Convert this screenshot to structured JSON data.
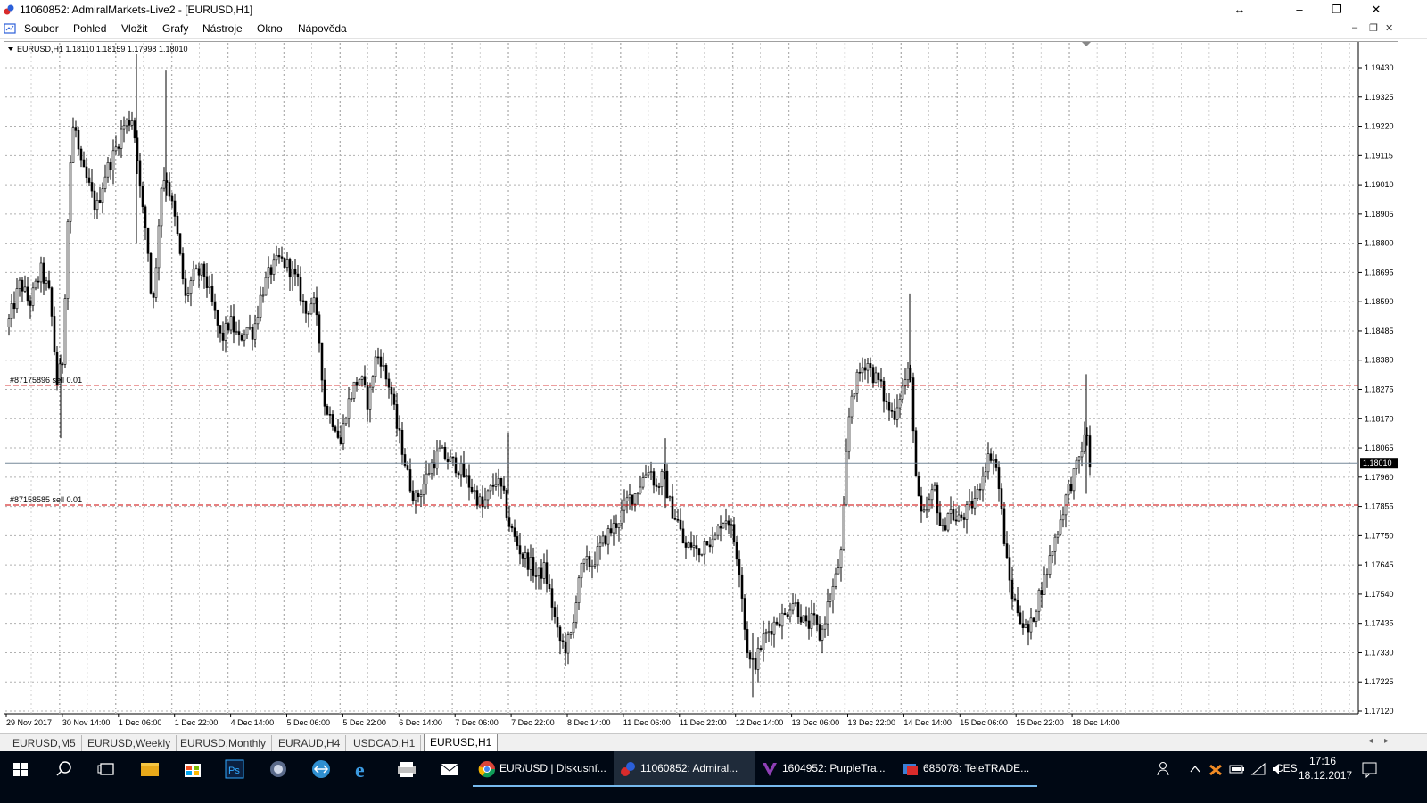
{
  "window": {
    "title": "11060852: AdmiralMarkets-Live2 - [EURUSD,H1]"
  },
  "menu": {
    "items": [
      "Soubor",
      "Pohled",
      "Vložit",
      "Grafy",
      "Nástroje",
      "Okno",
      "Nápověda"
    ]
  },
  "chart": {
    "info": "EURUSD,H1  1.18110 1.18159 1.17998 1.18010",
    "current_price": "1.18010",
    "order_lines": [
      {
        "label": "#87175896 sell 0.01",
        "price": 1.1829
      },
      {
        "label": "#87158585 sell 0.01",
        "price": 1.1786
      }
    ],
    "colors": {
      "order_line": "#cc0000",
      "bid_line": "#778899",
      "grid": "#b0b0b0",
      "candle": "#000000"
    }
  },
  "chart_data": {
    "type": "candlestick",
    "symbol": "EURUSD",
    "timeframe": "H1",
    "ylim": [
      1.1712,
      1.195
    ],
    "y_ticks": [
      "1.19430",
      "1.19325",
      "1.19220",
      "1.19115",
      "1.19010",
      "1.18905",
      "1.18800",
      "1.18695",
      "1.18590",
      "1.18485",
      "1.18380",
      "1.18275",
      "1.18170",
      "1.18065",
      "1.17960",
      "1.17855",
      "1.17750",
      "1.17645",
      "1.17540",
      "1.17435",
      "1.17330",
      "1.17225",
      "1.17120"
    ],
    "x_ticks": [
      "29 Nov 2017",
      "30 Nov 14:00",
      "1 Dec 06:00",
      "1 Dec 22:00",
      "4 Dec 14:00",
      "5 Dec 06:00",
      "5 Dec 22:00",
      "6 Dec 14:00",
      "7 Dec 06:00",
      "7 Dec 22:00",
      "8 Dec 14:00",
      "11 Dec 06:00",
      "11 Dec 22:00",
      "12 Dec 14:00",
      "13 Dec 06:00",
      "13 Dec 22:00",
      "14 Dec 14:00",
      "15 Dec 06:00",
      "15 Dec 22:00",
      "18 Dec 14:00"
    ],
    "price_path": [
      [
        0,
        1.185
      ],
      [
        15,
        1.1866
      ],
      [
        25,
        1.1858
      ],
      [
        38,
        1.187
      ],
      [
        48,
        1.1861
      ],
      [
        56,
        1.183
      ],
      [
        62,
        1.1838
      ],
      [
        70,
        1.1905
      ],
      [
        75,
        1.1925
      ],
      [
        82,
        1.1908
      ],
      [
        90,
        1.1902
      ],
      [
        100,
        1.1892
      ],
      [
        110,
        1.1905
      ],
      [
        120,
        1.1912
      ],
      [
        130,
        1.1922
      ],
      [
        140,
        1.1925
      ],
      [
        146,
        1.1912
      ],
      [
        150,
        1.1895
      ],
      [
        157,
        1.1882
      ],
      [
        162,
        1.1858
      ],
      [
        167,
        1.187
      ],
      [
        172,
        1.19
      ],
      [
        178,
        1.1905
      ],
      [
        184,
        1.1895
      ],
      [
        190,
        1.1885
      ],
      [
        195,
        1.1872
      ],
      [
        200,
        1.186
      ],
      [
        208,
        1.1868
      ],
      [
        220,
        1.187
      ],
      [
        230,
        1.1858
      ],
      [
        240,
        1.1845
      ],
      [
        250,
        1.1852
      ],
      [
        260,
        1.1845
      ],
      [
        268,
        1.185
      ],
      [
        276,
        1.1848
      ],
      [
        285,
        1.1862
      ],
      [
        295,
        1.187
      ],
      [
        305,
        1.1874
      ],
      [
        315,
        1.1872
      ],
      [
        325,
        1.1866
      ],
      [
        335,
        1.1855
      ],
      [
        343,
        1.186
      ],
      [
        350,
        1.1845
      ],
      [
        356,
        1.1822
      ],
      [
        362,
        1.1818
      ],
      [
        368,
        1.1815
      ],
      [
        374,
        1.1808
      ],
      [
        380,
        1.182
      ],
      [
        388,
        1.1828
      ],
      [
        396,
        1.1832
      ],
      [
        405,
        1.1822
      ],
      [
        412,
        1.1838
      ],
      [
        418,
        1.184
      ],
      [
        424,
        1.1832
      ],
      [
        430,
        1.1828
      ],
      [
        436,
        1.1815
      ],
      [
        442,
        1.1808
      ],
      [
        450,
        1.1795
      ],
      [
        458,
        1.1788
      ],
      [
        465,
        1.1792
      ],
      [
        475,
        1.18
      ],
      [
        485,
        1.1805
      ],
      [
        495,
        1.1802
      ],
      [
        505,
        1.18
      ],
      [
        515,
        1.1795
      ],
      [
        525,
        1.179
      ],
      [
        533,
        1.1785
      ],
      [
        540,
        1.179
      ],
      [
        548,
        1.1795
      ],
      [
        556,
        1.179
      ],
      [
        562,
        1.178
      ],
      [
        570,
        1.1773
      ],
      [
        578,
        1.1768
      ],
      [
        586,
        1.1765
      ],
      [
        594,
        1.176
      ],
      [
        602,
        1.1763
      ],
      [
        610,
        1.1752
      ],
      [
        618,
        1.1738
      ],
      [
        626,
        1.1735
      ],
      [
        634,
        1.174
      ],
      [
        640,
        1.176
      ],
      [
        648,
        1.1765
      ],
      [
        656,
        1.1765
      ],
      [
        664,
        1.177
      ],
      [
        672,
        1.1775
      ],
      [
        680,
        1.1778
      ],
      [
        688,
        1.1782
      ],
      [
        696,
        1.1788
      ],
      [
        704,
        1.179
      ],
      [
        712,
        1.1795
      ],
      [
        720,
        1.18
      ],
      [
        728,
        1.1792
      ],
      [
        736,
        1.1797
      ],
      [
        744,
        1.1785
      ],
      [
        752,
        1.178
      ],
      [
        760,
        1.177
      ],
      [
        768,
        1.1772
      ],
      [
        776,
        1.1768
      ],
      [
        784,
        1.1775
      ],
      [
        792,
        1.1772
      ],
      [
        800,
        1.178
      ],
      [
        808,
        1.1782
      ],
      [
        816,
        1.1772
      ],
      [
        822,
        1.1762
      ],
      [
        828,
        1.1738
      ],
      [
        834,
        1.1728
      ],
      [
        840,
        1.173
      ],
      [
        848,
        1.1738
      ],
      [
        856,
        1.1742
      ],
      [
        864,
        1.1745
      ],
      [
        872,
        1.1746
      ],
      [
        880,
        1.1752
      ],
      [
        888,
        1.1748
      ],
      [
        896,
        1.1742
      ],
      [
        904,
        1.1745
      ],
      [
        912,
        1.1738
      ],
      [
        920,
        1.175
      ],
      [
        928,
        1.1758
      ],
      [
        936,
        1.177
      ],
      [
        942,
        1.181
      ],
      [
        946,
        1.1825
      ],
      [
        952,
        1.183
      ],
      [
        958,
        1.1835
      ],
      [
        964,
        1.1838
      ],
      [
        970,
        1.1833
      ],
      [
        978,
        1.183
      ],
      [
        986,
        1.1822
      ],
      [
        994,
        1.1818
      ],
      [
        1000,
        1.1825
      ],
      [
        1006,
        1.183
      ],
      [
        1012,
        1.1835
      ],
      [
        1016,
        1.1815
      ],
      [
        1020,
        1.179
      ],
      [
        1026,
        1.178
      ],
      [
        1032,
        1.1785
      ],
      [
        1040,
        1.1792
      ],
      [
        1048,
        1.1775
      ],
      [
        1056,
        1.1785
      ],
      [
        1064,
        1.178
      ],
      [
        1072,
        1.1782
      ],
      [
        1080,
        1.1785
      ],
      [
        1088,
        1.179
      ],
      [
        1096,
        1.18
      ],
      [
        1104,
        1.1805
      ],
      [
        1110,
        1.1798
      ],
      [
        1116,
        1.178
      ],
      [
        1122,
        1.1762
      ],
      [
        1128,
        1.1752
      ],
      [
        1134,
        1.1748
      ],
      [
        1140,
        1.1742
      ],
      [
        1146,
        1.174
      ],
      [
        1152,
        1.1748
      ],
      [
        1158,
        1.1755
      ],
      [
        1164,
        1.176
      ],
      [
        1170,
        1.1768
      ],
      [
        1176,
        1.1775
      ],
      [
        1182,
        1.1782
      ],
      [
        1188,
        1.179
      ],
      [
        1194,
        1.1795
      ],
      [
        1200,
        1.18
      ],
      [
        1206,
        1.1808
      ],
      [
        1212,
        1.1812
      ],
      [
        1214,
        1.1801
      ]
    ],
    "spikes": [
      {
        "x": 145,
        "high": 1.1948,
        "low": 1.188
      },
      {
        "x": 178,
        "high": 1.1942,
        "low": 1.1895
      },
      {
        "x": 60,
        "high": 1.184,
        "low": 1.181
      },
      {
        "x": 1012,
        "high": 1.1862,
        "low": 1.183
      },
      {
        "x": 1210,
        "high": 1.1833,
        "low": 1.179
      },
      {
        "x": 836,
        "high": 1.174,
        "low": 1.1717
      },
      {
        "x": 562,
        "high": 1.1812,
        "low": 1.179
      },
      {
        "x": 738,
        "high": 1.181,
        "low": 1.1785
      }
    ]
  },
  "tabs": {
    "items": [
      "EURUSD,M5",
      "EURUSD,Weekly",
      "EURUSD,Monthly",
      "EURAUD,H4",
      "USDCAD,H1",
      "EURUSD,H1"
    ],
    "active": "EURUSD,H1"
  },
  "taskbar": {
    "apps": [
      {
        "label": "EUR/USD | Diskusní...",
        "icon": "chrome-icon"
      },
      {
        "label": "11060852: Admiral...",
        "icon": "metatrader-icon"
      },
      {
        "label": "1604952: PurpleTra...",
        "icon": "purpletrader-icon"
      },
      {
        "label": "685078: TeleTRADE...",
        "icon": "teletrade-icon"
      }
    ],
    "lang": "CES",
    "time": "17:16",
    "date": "18.12.2017"
  }
}
